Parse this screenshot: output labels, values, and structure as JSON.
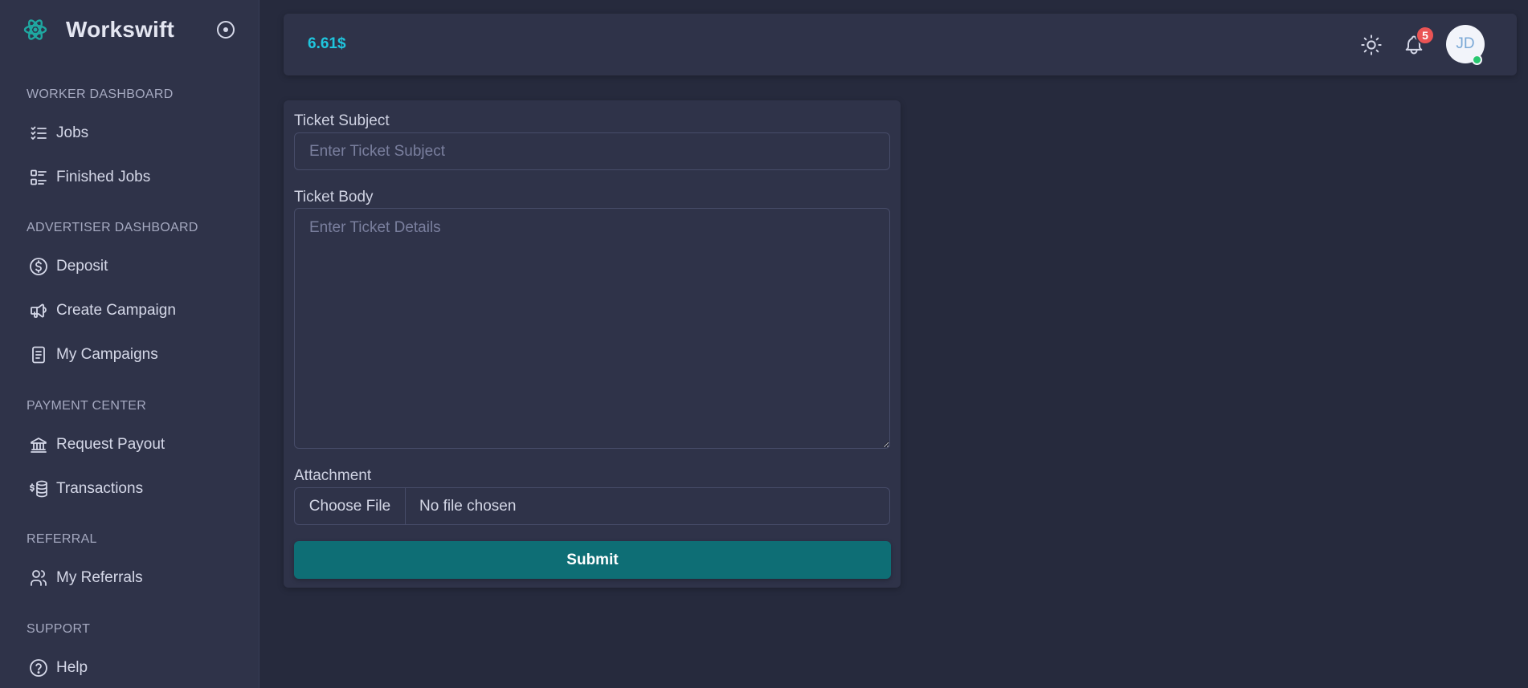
{
  "brand": {
    "name": "Workswift",
    "accent": "#1fa8a1"
  },
  "sidebar": {
    "sections": [
      {
        "title": "WORKER DASHBOARD"
      },
      {
        "title": "ADVERTISER DASHBOARD"
      },
      {
        "title": "PAYMENT CENTER"
      },
      {
        "title": "REFERRAL"
      },
      {
        "title": "SUPPORT"
      }
    ],
    "items": [
      {
        "label": "Jobs",
        "icon": "list-check-icon"
      },
      {
        "label": "Finished Jobs",
        "icon": "list-details-icon"
      },
      {
        "label": "Deposit",
        "icon": "dollar-circle-icon"
      },
      {
        "label": "Create Campaign",
        "icon": "megaphone-icon"
      },
      {
        "label": "My Campaigns",
        "icon": "file-text-icon"
      },
      {
        "label": "Request Payout",
        "icon": "bank-icon"
      },
      {
        "label": "Transactions",
        "icon": "coins-icon"
      },
      {
        "label": "My Referrals",
        "icon": "users-icon"
      },
      {
        "label": "Help",
        "icon": "help-circle-icon"
      }
    ]
  },
  "header": {
    "balance": "6.61$",
    "balance_color": "#1fc6de",
    "notifications_count": "5",
    "avatar_initials": "JD"
  },
  "form": {
    "subject_label": "Ticket Subject",
    "subject_placeholder": "Enter Ticket Subject",
    "body_label": "Ticket Body",
    "body_placeholder": "Enter Ticket Details",
    "attachment_label": "Attachment",
    "choose_file": "Choose File",
    "file_status": "No file chosen",
    "submit_label": "Submit",
    "submit_color": "#0e6e75"
  }
}
